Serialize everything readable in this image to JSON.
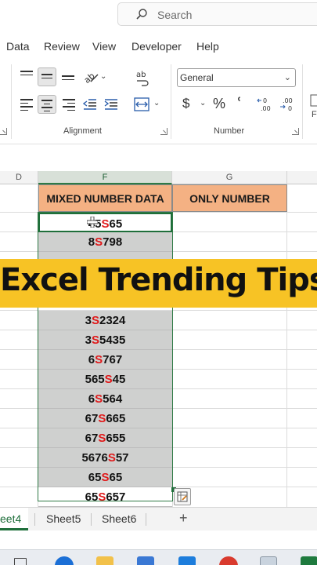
{
  "search": {
    "placeholder": "Search",
    "icon": "search-icon"
  },
  "menu": {
    "tabs": [
      "Data",
      "Review",
      "View",
      "Developer",
      "Help"
    ]
  },
  "ribbon": {
    "alignment_group_label": "Alignment",
    "number_group_label": "Number",
    "number_format_value": "General",
    "currency_symbol": "$",
    "percent_symbol": "%",
    "comma_symbol": "ՙ",
    "partial_right_label": "F"
  },
  "grid": {
    "column_letters": [
      "D",
      "F",
      "G"
    ],
    "header_mixed": "MIXED NUMBER DATA",
    "header_only": "ONLY NUMBER",
    "rows": [
      {
        "pre": "4",
        "s": "S",
        "post": "65",
        "mid": "5",
        "note": "cursor overlaps"
      },
      {
        "pre": "8",
        "s": "S",
        "post": "798"
      },
      {
        "pre": "3",
        "s": "S",
        "post": "2324"
      },
      {
        "pre": "3",
        "s": "S",
        "post": "5435"
      },
      {
        "pre": "6",
        "s": "S",
        "post": "767"
      },
      {
        "pre": "565",
        "s": "S",
        "post": "45"
      },
      {
        "pre": "6",
        "s": "S",
        "post": "564"
      },
      {
        "pre": "67",
        "s": "S",
        "post": "665"
      },
      {
        "pre": "67",
        "s": "S",
        "post": "655"
      },
      {
        "pre": "5676",
        "s": "S",
        "post": "57"
      },
      {
        "pre": "65",
        "s": "S",
        "post": "65"
      },
      {
        "pre": "65",
        "s": "S",
        "post": "657"
      }
    ]
  },
  "banner": {
    "text": "Excel Trending Tips",
    "color": "#f7c325"
  },
  "sheets": {
    "tabs": [
      "eet4",
      "Sheet5",
      "Sheet6"
    ],
    "add": "+"
  },
  "colors": {
    "header_fill": "#f4b183",
    "accent_green": "#1e6e3a",
    "red_s": "#e0191a"
  }
}
